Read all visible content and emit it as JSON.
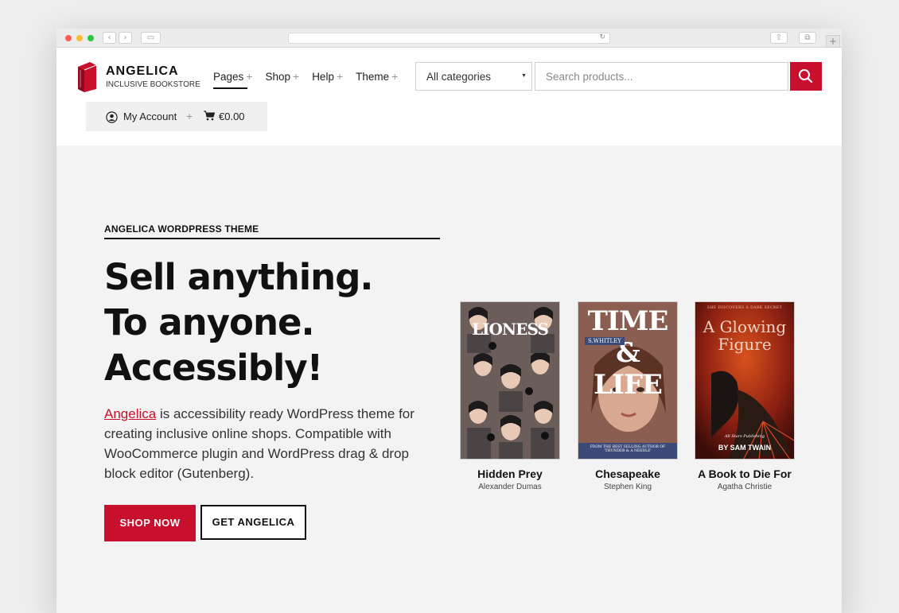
{
  "brand": {
    "name": "ANGELICA",
    "tagline": "INCLUSIVE BOOKSTORE",
    "accent": "#c8102e"
  },
  "nav": [
    {
      "label": "Pages"
    },
    {
      "label": "Shop"
    },
    {
      "label": "Help"
    },
    {
      "label": "Theme"
    }
  ],
  "nav_plus": "+",
  "search": {
    "category": "All categories",
    "placeholder": "Search products..."
  },
  "account": {
    "label": "My Account",
    "cart_total": "€0.00"
  },
  "hero": {
    "eyebrow": "ANGELICA WORDPRESS THEME",
    "headline": [
      "Sell anything.",
      "To anyone.",
      "Accessibly!"
    ],
    "intro_link": "Angelica",
    "intro_text": " is accessibility ready WordPress theme for creating inclusive online shops. Compatible with WooCommerce plugin and WordPress drag & drop block editor (Gutenberg).",
    "primary_button": "SHOP NOW",
    "secondary_button": "GET ANGELICA"
  },
  "books": [
    {
      "title": "Hidden Prey",
      "author": "Alexander Dumas",
      "cover_text": "LIONESS",
      "cover_color": "#6b5f5c"
    },
    {
      "title": "Chesapeake",
      "author": "Stephen King",
      "cover_text": "TIME & LIFE",
      "cover_subtext": "S.WHITLEY",
      "cover_footer": "FROM THE BEST SELLING AUTHOR OF 'THUNDER & A NEEDLE'",
      "cover_color": "#8a5a4c"
    },
    {
      "title": "A Book to Die For",
      "author": "Agatha Christie",
      "cover_text": "A Glowing Figure",
      "cover_kicker": "SHE DISCOVERS A DARK SECRET",
      "cover_publisher": "All Stars Publishing",
      "cover_footer": "BY SAM TWAIN",
      "cover_color": "#8b1a10"
    }
  ]
}
